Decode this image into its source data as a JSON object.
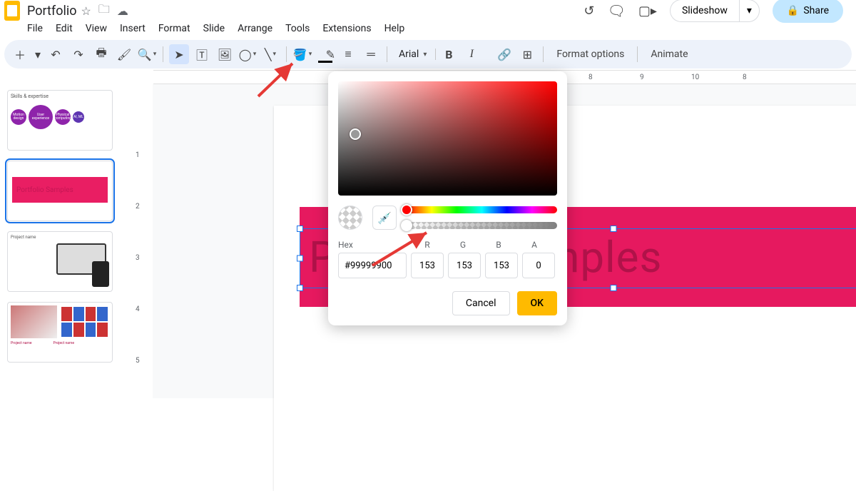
{
  "doc": {
    "title": "Portfolio"
  },
  "menu": {
    "file": "File",
    "edit": "Edit",
    "view": "View",
    "insert": "Insert",
    "format": "Format",
    "slide": "Slide",
    "arrange": "Arrange",
    "tools": "Tools",
    "extensions": "Extensions",
    "help": "Help"
  },
  "header_buttons": {
    "slideshow": "Slideshow",
    "share": "Share"
  },
  "toolbar": {
    "font": "Arial",
    "format_options": "Format options",
    "animate": "Animate"
  },
  "ruler": {
    "h": [
      "8",
      "9",
      "10"
    ],
    "v": [
      "1",
      "2",
      "3",
      "4",
      "5"
    ]
  },
  "ruler_top_right": [
    "8",
    "9"
  ],
  "slide_text": "Portfolio Samples",
  "thumbs": {
    "t1_title": "Skills & expertise",
    "t1_bubbles": [
      "Motion design",
      "User experience",
      "Physical computing",
      "AI, ML"
    ],
    "t2_text": "Portfolio Samples",
    "t3_title": "Project name",
    "t4_titles": [
      "Project name",
      "Project name"
    ]
  },
  "picker": {
    "labels": {
      "hex": "Hex",
      "r": "R",
      "g": "G",
      "b": "B",
      "a": "A"
    },
    "hex": "#99999900",
    "r": "153",
    "g": "153",
    "b": "153",
    "a": "0",
    "cancel": "Cancel",
    "ok": "OK"
  }
}
